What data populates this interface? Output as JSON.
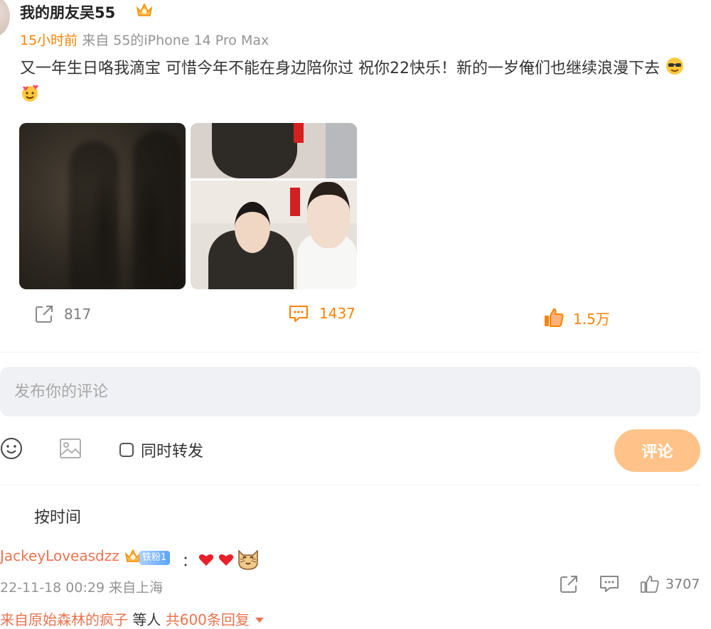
{
  "post": {
    "author": "我的朋友吴55",
    "time": "15小时前",
    "source": "来自 55的iPhone 14 Pro Max",
    "text": "又一年生日咯我滴宝 可惜今年不能在身边陪你过 祝你22快乐！新的一岁俺们也继续浪漫下去",
    "emojis": [
      "cool-sunglasses-emoji",
      "hearts-smile-emoji"
    ],
    "images": [
      "shadow-photo",
      "photo-top",
      "photo-bottom"
    ]
  },
  "actions": {
    "repost_count": "817",
    "comment_count": "1437",
    "like_count": "1.5万"
  },
  "composer": {
    "placeholder": "发布你的评论",
    "sync_label": "同时转发",
    "submit_label": "评论"
  },
  "sort": {
    "label": "按时间"
  },
  "comment": {
    "user": "JackeyLoveasdzz",
    "badge": "铁粉1",
    "text": "：",
    "meta": "22-11-18 00:29 来自上海",
    "like_count": "3707"
  },
  "replies": {
    "prefix": "来自原始森林的疯子",
    "middle": " 等人 ",
    "total": "共600条回复"
  },
  "colors": {
    "accent": "#ff8200",
    "link": "#eb7350",
    "submit_disabled": "#ffc389"
  }
}
